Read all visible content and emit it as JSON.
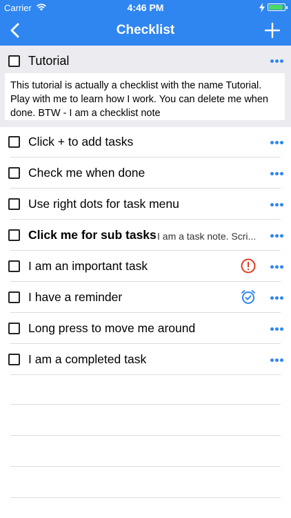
{
  "status_bar": {
    "carrier": "Carrier",
    "time": "4:46 PM",
    "battery_level": 0.9
  },
  "nav": {
    "title": "Checklist",
    "back_icon": "chevron-left-icon",
    "add_icon": "plus-icon"
  },
  "tutorial": {
    "title": "Tutorial",
    "note": "This tutorial is actually a checklist with the name Tutorial. Play with me to learn how I work. You can delete me when done. BTW - I am a checklist note"
  },
  "tasks": [
    {
      "label": "Click + to add tasks",
      "note": "",
      "icon": ""
    },
    {
      "label": "Check me when done",
      "note": "",
      "icon": ""
    },
    {
      "label": "Use right dots for task menu",
      "note": "",
      "icon": ""
    },
    {
      "label": "Click me for sub tasks",
      "note": "I am a task note. Scri...",
      "icon": ""
    },
    {
      "label": "I am an important task",
      "note": "",
      "icon": "important-icon"
    },
    {
      "label": "I have a reminder",
      "note": "",
      "icon": "alarm-clock-icon"
    },
    {
      "label": "Long press to move me around",
      "note": "",
      "icon": ""
    },
    {
      "label": "I am a completed task",
      "note": "",
      "icon": ""
    }
  ],
  "colors": {
    "accent": "#2f86f0",
    "important": "#e0391f",
    "section_bg": "#ececf0"
  }
}
